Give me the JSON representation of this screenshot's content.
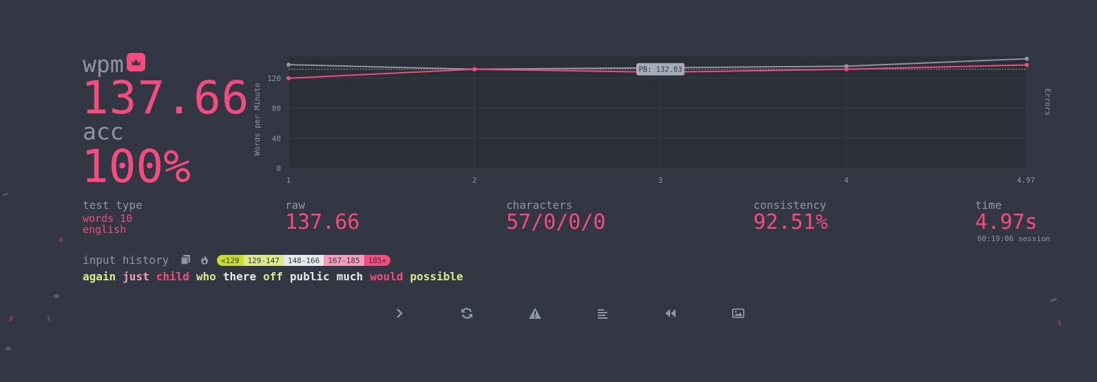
{
  "result": {
    "wpm_label": "wpm",
    "wpm": "137.66",
    "acc_label": "acc",
    "acc": "100%"
  },
  "chart_data": {
    "type": "line",
    "x": [
      1,
      2,
      3,
      4,
      4.97
    ],
    "x_tick_labels": [
      "1",
      "2",
      "3",
      "4",
      "4.97"
    ],
    "ylabel": "Words per Minute",
    "y2label": "Errors",
    "ylim": [
      0,
      140
    ],
    "y_ticks": [
      0,
      40,
      80,
      120
    ],
    "grid": true,
    "series": [
      {
        "values": [
          120,
          132,
          128,
          132,
          137.66
        ],
        "color": "#f44c7f"
      },
      {
        "values": [
          138,
          132,
          134,
          136,
          146
        ],
        "color": "#8f96a3"
      }
    ],
    "annotation": {
      "label": "PB: 132.03",
      "value": 132.03
    }
  },
  "stats": {
    "test_type_label": "test type",
    "test_type_line1": "words 10",
    "test_type_line2": "english",
    "raw_label": "raw",
    "raw": "137.66",
    "characters_label": "characters",
    "characters": "57/0/0/0",
    "consistency_label": "consistency",
    "consistency": "92.51%",
    "time_label": "time",
    "time": "4.97s",
    "session": "00:19:06 session"
  },
  "history": {
    "label": "input history",
    "copy_icon": "copy-icon",
    "heatmap_icon": "fire-icon",
    "legend": [
      {
        "label": "<129",
        "color": "#c6dd2b"
      },
      {
        "label": "129-147",
        "color": "#dbe88c"
      },
      {
        "label": "148-166",
        "color": "#e8e9eb"
      },
      {
        "label": "167-185",
        "color": "#f29dba"
      },
      {
        "label": "185+",
        "color": "#f44c7f"
      }
    ],
    "words": [
      {
        "text": "again",
        "color": "#dbe88c"
      },
      {
        "text": "just",
        "color": "#f29dba"
      },
      {
        "text": "child",
        "color": "#f44c7f"
      },
      {
        "text": "who",
        "color": "#dbe88c"
      },
      {
        "text": "there",
        "color": "#e8e9eb"
      },
      {
        "text": "off",
        "color": "#dbe88c"
      },
      {
        "text": "public",
        "color": "#e8e9eb"
      },
      {
        "text": "much",
        "color": "#e8e9eb"
      },
      {
        "text": "would",
        "color": "#f44c7f"
      },
      {
        "text": "possible",
        "color": "#dbe88c"
      }
    ]
  },
  "buttons": [
    {
      "name": "next-test-button",
      "icon": "chevron-right-icon"
    },
    {
      "name": "restart-test-button",
      "icon": "refresh-icon"
    },
    {
      "name": "report-button",
      "icon": "warning-icon"
    },
    {
      "name": "show-words-history-button",
      "icon": "align-left-icon"
    },
    {
      "name": "replay-button",
      "icon": "rewind-icon"
    },
    {
      "name": "save-screenshot-button",
      "icon": "image-icon"
    }
  ]
}
